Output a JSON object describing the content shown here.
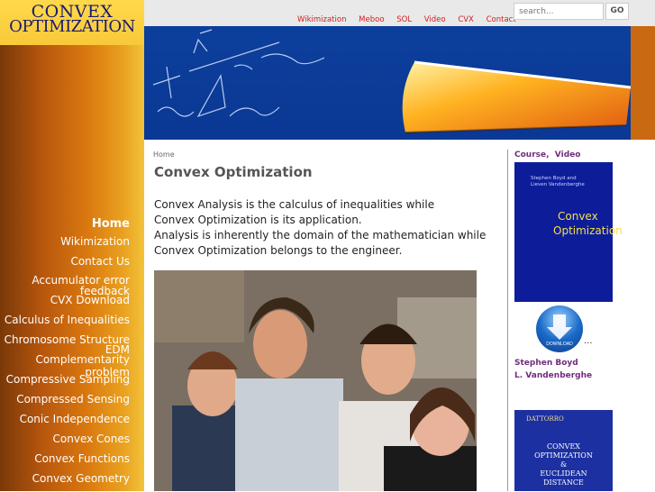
{
  "logo": {
    "line1": "CONVEX",
    "line2": "OPTIMIZATION"
  },
  "top_nav": [
    "Wikimization",
    "Meboo",
    "SOL",
    "Video",
    "CVX",
    "Contact"
  ],
  "search": {
    "placeholder": "search...",
    "button": "GO"
  },
  "sidebar": {
    "items": [
      {
        "label": "Home",
        "active": true
      },
      {
        "label": "Wikimization"
      },
      {
        "label": "Contact Us"
      },
      {
        "label": "Accumulator error feedback"
      },
      {
        "label": "CVX Download"
      },
      {
        "label": "Calculus of Inequalities"
      },
      {
        "label": "Chromosome Structure"
      },
      {
        "label": "EDM"
      },
      {
        "label": "Complementarity problem"
      },
      {
        "label": "Compressive Sampling"
      },
      {
        "label": "Compressed Sensing"
      },
      {
        "label": "Conic Independence"
      },
      {
        "label": "Convex Cones"
      },
      {
        "label": "Convex Functions"
      },
      {
        "label": "Convex Geometry"
      }
    ]
  },
  "main": {
    "breadcrumb": "Home",
    "title": "Convex Optimization",
    "intro": [
      "Convex Analysis is the calculus of inequalities while",
      "Convex Optimization is its application.",
      "Analysis is inherently the domain of the mathematician while",
      "Convex Optimization belongs to the engineer."
    ]
  },
  "right": {
    "course": "Course,",
    "video": "Video",
    "book1": {
      "authors_line1": "Stephen Boyd and",
      "authors_line2": "Lieven Vandenberghe",
      "title1": "Convex",
      "title2": "Optimization"
    },
    "download": "DOWNLOAD",
    "ellipsis": "...",
    "author1": "Stephen Boyd",
    "author2": "L. Vandenberghe",
    "book2": {
      "publisher": "DATTORRO",
      "line1": "CONVEX",
      "line2": "OPTIMIZATION",
      "line3": "&",
      "line4": "EUCLIDEAN",
      "line5": "DISTANCE"
    }
  },
  "colors": {
    "nav_red": "#d1201e",
    "link_purple": "#722b7e",
    "banner_blue": "#0c3f9c",
    "sidebar_orange": "#d9780f"
  }
}
